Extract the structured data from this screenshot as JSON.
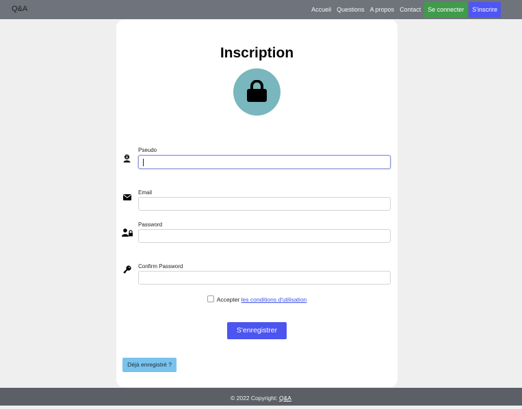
{
  "navbar": {
    "brand": "Q&A",
    "links": [
      "Accueil",
      "Questions",
      "A propos",
      "Contact"
    ],
    "login_label": "Se connecter",
    "register_label": "S'inscrire"
  },
  "form": {
    "title": "Inscription",
    "fields": [
      {
        "label": "Pseudo",
        "value": "",
        "icon": "user-icon"
      },
      {
        "label": "Email",
        "value": "",
        "icon": "envelope-icon"
      },
      {
        "label": "Password",
        "value": "",
        "icon": "user-lock-icon"
      },
      {
        "label": "Confirm Password",
        "value": "",
        "icon": "key-icon"
      }
    ],
    "terms_prefix": "Accepter ",
    "terms_link": "les conditions d'utilisation",
    "submit_label": "S'enregistrer",
    "already_label": "Déjà enregistré ?"
  },
  "footer": {
    "text": "© 2022 Copyright: ",
    "link": "Q&A"
  },
  "colors": {
    "accent": "#4c55f0",
    "success": "#409b4b",
    "lock_circle": "#79b6bd"
  }
}
